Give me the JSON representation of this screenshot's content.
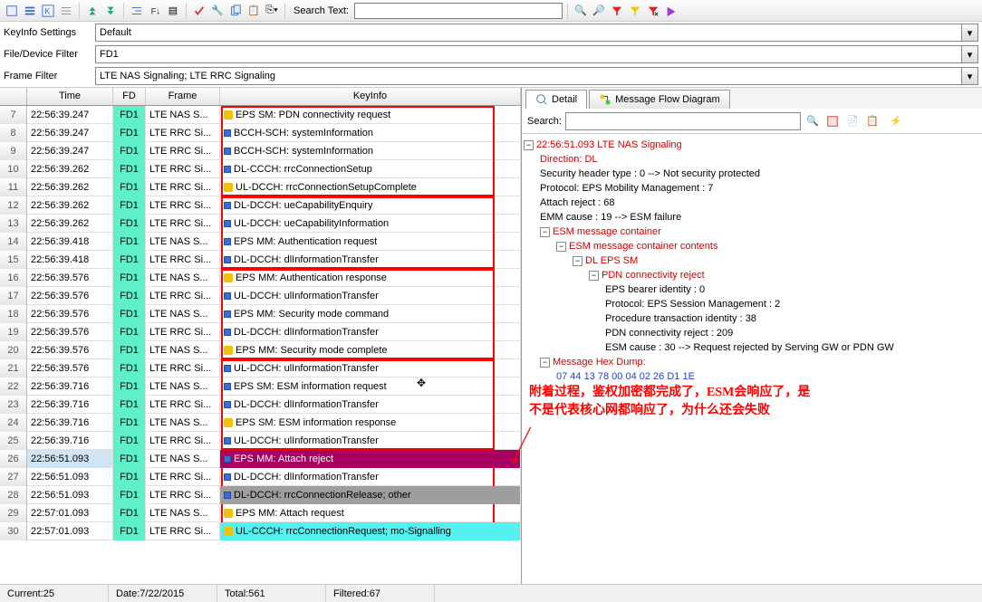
{
  "toolbar": {
    "search_label": "Search Text:",
    "search_value": ""
  },
  "keyinfo": {
    "label": "KeyInfo Settings",
    "value": "Default"
  },
  "filefilter": {
    "label": "File/Device Filter",
    "value": "FD1"
  },
  "framefilter": {
    "label": "Frame Filter",
    "value": "LTE NAS Signaling; LTE RRC Signaling"
  },
  "gridhead": {
    "time": "Time",
    "fd": "FD",
    "frame": "Frame",
    "key": "KeyInfo"
  },
  "rows": [
    {
      "idx": "7",
      "time": "22:56:39.247",
      "fd": "FD1",
      "frame": "LTE NAS S...",
      "key": "EPS SM: PDN connectivity request",
      "ico": "y"
    },
    {
      "idx": "8",
      "time": "22:56:39.247",
      "fd": "FD1",
      "frame": "LTE RRC Si...",
      "key": "BCCH-SCH: systemInformation",
      "ico": "b"
    },
    {
      "idx": "9",
      "time": "22:56:39.247",
      "fd": "FD1",
      "frame": "LTE RRC Si...",
      "key": "BCCH-SCH: systemInformation",
      "ico": "b"
    },
    {
      "idx": "10",
      "time": "22:56:39.262",
      "fd": "FD1",
      "frame": "LTE RRC Si...",
      "key": "DL-CCCH: rrcConnectionSetup",
      "ico": "b"
    },
    {
      "idx": "11",
      "time": "22:56:39.262",
      "fd": "FD1",
      "frame": "LTE RRC Si...",
      "key": "UL-DCCH: rrcConnectionSetupComplete",
      "ico": "y"
    },
    {
      "idx": "12",
      "time": "22:56:39.262",
      "fd": "FD1",
      "frame": "LTE RRC Si...",
      "key": "DL-DCCH: ueCapabilityEnquiry",
      "ico": "b"
    },
    {
      "idx": "13",
      "time": "22:56:39.262",
      "fd": "FD1",
      "frame": "LTE RRC Si...",
      "key": "UL-DCCH: ueCapabilityInformation",
      "ico": "b"
    },
    {
      "idx": "14",
      "time": "22:56:39.418",
      "fd": "FD1",
      "frame": "LTE NAS S...",
      "key": "EPS MM: Authentication request",
      "ico": "b"
    },
    {
      "idx": "15",
      "time": "22:56:39.418",
      "fd": "FD1",
      "frame": "LTE RRC Si...",
      "key": "DL-DCCH: dlInformationTransfer",
      "ico": "b"
    },
    {
      "idx": "16",
      "time": "22:56:39.576",
      "fd": "FD1",
      "frame": "LTE NAS S...",
      "key": "EPS MM: Authentication response",
      "ico": "y"
    },
    {
      "idx": "17",
      "time": "22:56:39.576",
      "fd": "FD1",
      "frame": "LTE RRC Si...",
      "key": "UL-DCCH: ulInformationTransfer",
      "ico": "b"
    },
    {
      "idx": "18",
      "time": "22:56:39.576",
      "fd": "FD1",
      "frame": "LTE NAS S...",
      "key": "EPS MM: Security mode command",
      "ico": "b"
    },
    {
      "idx": "19",
      "time": "22:56:39.576",
      "fd": "FD1",
      "frame": "LTE RRC Si...",
      "key": "DL-DCCH: dlInformationTransfer",
      "ico": "b"
    },
    {
      "idx": "20",
      "time": "22:56:39.576",
      "fd": "FD1",
      "frame": "LTE NAS S...",
      "key": "EPS MM: Security mode complete",
      "ico": "y"
    },
    {
      "idx": "21",
      "time": "22:56:39.576",
      "fd": "FD1",
      "frame": "LTE RRC Si...",
      "key": "UL-DCCH: ulInformationTransfer",
      "ico": "b"
    },
    {
      "idx": "22",
      "time": "22:56:39.716",
      "fd": "FD1",
      "frame": "LTE NAS S...",
      "key": "EPS SM: ESM information request",
      "ico": "b"
    },
    {
      "idx": "23",
      "time": "22:56:39.716",
      "fd": "FD1",
      "frame": "LTE RRC Si...",
      "key": "DL-DCCH: dlInformationTransfer",
      "ico": "b"
    },
    {
      "idx": "24",
      "time": "22:56:39.716",
      "fd": "FD1",
      "frame": "LTE NAS S...",
      "key": "EPS SM: ESM information response",
      "ico": "y"
    },
    {
      "idx": "25",
      "time": "22:56:39.716",
      "fd": "FD1",
      "frame": "LTE RRC Si...",
      "key": "UL-DCCH: ulInformationTransfer",
      "ico": "b"
    },
    {
      "idx": "26",
      "time": "22:56:51.093",
      "fd": "FD1",
      "frame": "LTE NAS S...",
      "key": "EPS MM: Attach reject",
      "ico": "b",
      "sel": true
    },
    {
      "idx": "27",
      "time": "22:56:51.093",
      "fd": "FD1",
      "frame": "LTE RRC Si...",
      "key": "DL-DCCH: dlInformationTransfer",
      "ico": "b"
    },
    {
      "idx": "28",
      "time": "22:56:51.093",
      "fd": "FD1",
      "frame": "LTE RRC Si...",
      "key": "DL-DCCH: rrcConnectionRelease;  other",
      "ico": "b",
      "grey": true
    },
    {
      "idx": "29",
      "time": "22:57:01.093",
      "fd": "FD1",
      "frame": "LTE NAS S...",
      "key": "EPS MM: Attach request",
      "ico": "y"
    },
    {
      "idx": "30",
      "time": "22:57:01.093",
      "fd": "FD1",
      "frame": "LTE RRC Si...",
      "key": "UL-CCCH: rrcConnectionRequest;  mo-Signalling",
      "ico": "y",
      "cyan": true
    }
  ],
  "status": {
    "current": "Current:25",
    "date": "Date:7/22/2015",
    "total": "Total:561",
    "filtered": "Filtered:67"
  },
  "tabs": {
    "detail": "Detail",
    "flow": "Message Flow Diagram"
  },
  "rsearch": {
    "label": "Search:",
    "value": ""
  },
  "tree": {
    "root": "22:56:51.093 LTE NAS Signaling",
    "dir": "Direction: DL",
    "sht": "Security header type : 0 --> Not security protected",
    "proto": "Protocol: EPS Mobility Management : 7",
    "attrej": "Attach reject : 68",
    "emm": "EMM cause : 19 --> ESM failure",
    "esmc": "ESM message container",
    "esmcc": "ESM message container contents",
    "dleps": "DL EPS SM",
    "pdnrej": "PDN connectivity reject",
    "epsb": "EPS bearer identity : 0",
    "proto2": "Protocol: EPS Session Management : 2",
    "proctx": "Procedure transaction identity : 38",
    "pdnrej2": "PDN connectivity reject : 209",
    "esmcause": "ESM cause : 30 --> Request rejected by Serving GW or PDN GW",
    "hexh": "Message Hex Dump:",
    "hex": "07 44 13 78 00 04 02 26 D1 1E"
  },
  "annotation": {
    "line1": "附着过程，鉴权加密都完成了，ESM会响应了，是",
    "line2": "不是代表核心网都响应了，为什么还会失败"
  }
}
